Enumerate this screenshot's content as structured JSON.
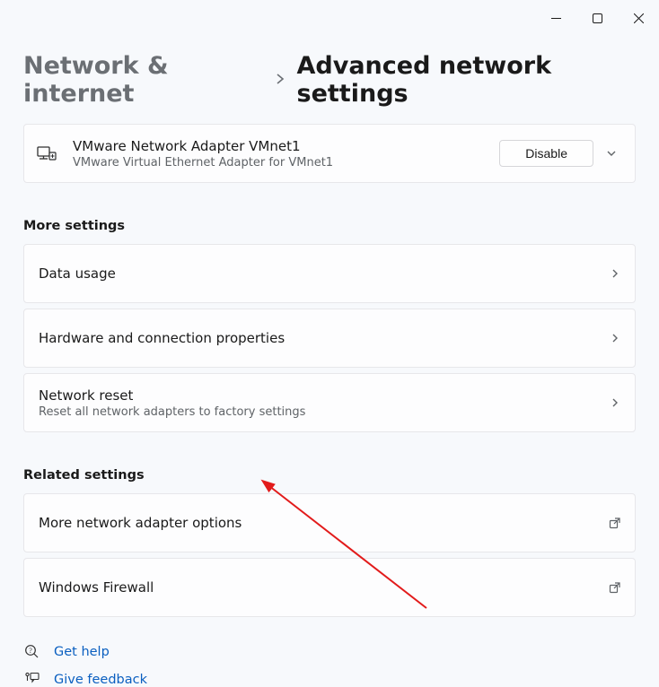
{
  "breadcrumb": {
    "parent": "Network & internet",
    "current": "Advanced network settings"
  },
  "adapter": {
    "title": "VMware Network Adapter VMnet1",
    "subtitle": "VMware Virtual Ethernet Adapter for VMnet1",
    "button": "Disable"
  },
  "sections": {
    "more": "More settings",
    "related": "Related settings"
  },
  "rows": {
    "data_usage": "Data usage",
    "hardware": "Hardware and connection properties",
    "reset_title": "Network reset",
    "reset_sub": "Reset all network adapters to factory settings",
    "more_adapter": "More network adapter options",
    "firewall": "Windows Firewall"
  },
  "footer": {
    "help": "Get help",
    "feedback": "Give feedback"
  }
}
